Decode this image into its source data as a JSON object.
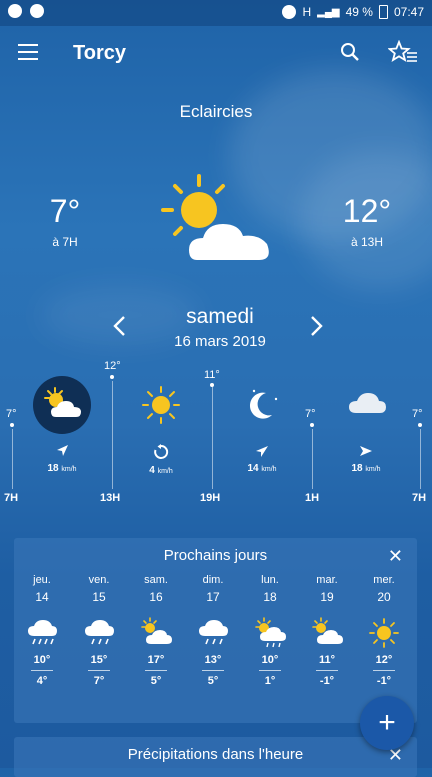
{
  "status": {
    "battery": "49 %",
    "time": "07:47",
    "network": "H"
  },
  "app": {
    "city": "Torcy"
  },
  "current": {
    "condition": "Eclaircies",
    "temp_min": "7°",
    "temp_min_time": "à 7H",
    "temp_max": "12°",
    "temp_max_time": "à 13H",
    "icon": "sun-cloud-icon"
  },
  "day": {
    "name": "samedi",
    "date": "16 mars 2019"
  },
  "timeline": {
    "hours": [
      "7H",
      "13H",
      "19H",
      "1H",
      "7H"
    ],
    "temps": [
      "7°",
      "12°",
      "11°",
      "7°",
      "7°"
    ],
    "slots": [
      {
        "icon": "sun-cloud-icon",
        "wind": "18",
        "unit": "km/h"
      },
      {
        "icon": "sun-icon",
        "wind": "4",
        "unit": "km/h"
      },
      {
        "icon": "moon-icon",
        "wind": "14",
        "unit": "km/h"
      },
      {
        "icon": "cloud-icon",
        "wind": "18",
        "unit": "km/h"
      }
    ]
  },
  "forecast": {
    "title": "Prochains jours",
    "days": [
      {
        "name": "jeu.",
        "num": "14",
        "icon": "rain-cloud-icon",
        "hi": "10°",
        "lo": "4°"
      },
      {
        "name": "ven.",
        "num": "15",
        "icon": "rain-cloud-icon",
        "hi": "15°",
        "lo": "7°"
      },
      {
        "name": "sam.",
        "num": "16",
        "icon": "sun-cloud-icon",
        "hi": "17°",
        "lo": "5°"
      },
      {
        "name": "dim.",
        "num": "17",
        "icon": "rain-cloud-icon",
        "hi": "13°",
        "lo": "5°"
      },
      {
        "name": "lun.",
        "num": "18",
        "icon": "sun-rain-cloud-icon",
        "hi": "10°",
        "lo": "1°"
      },
      {
        "name": "mar.",
        "num": "19",
        "icon": "sun-cloud-icon",
        "hi": "11°",
        "lo": "-1°"
      },
      {
        "name": "mer.",
        "num": "20",
        "icon": "sun-icon",
        "hi": "12°",
        "lo": "-1°"
      }
    ]
  },
  "precip": {
    "title": "Précipitations dans l'heure"
  },
  "colors": {
    "sun": "#f7c520",
    "background": "#2a6eb2",
    "fab": "#1b58a8"
  }
}
